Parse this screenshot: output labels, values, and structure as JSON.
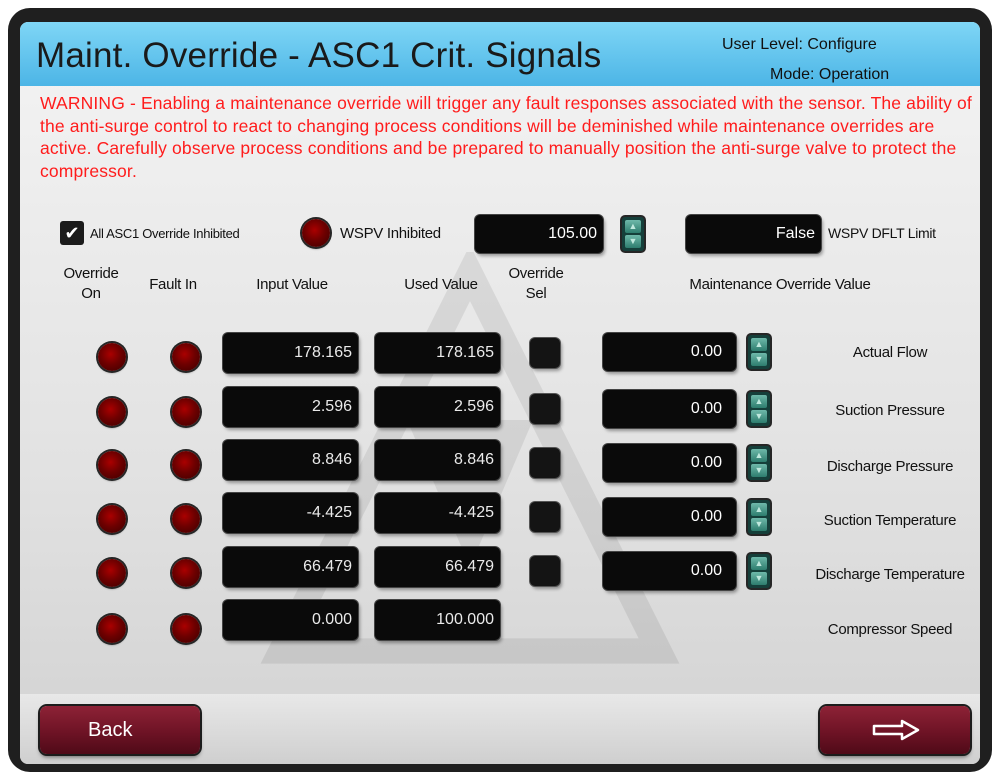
{
  "header": {
    "title": "Maint. Override - ASC1 Crit. Signals",
    "user_level": "User Level: Configure",
    "mode": "Mode: Operation"
  },
  "warning": "WARNING - Enabling a maintenance override will trigger any fault responses associated with the sensor. The ability of the anti-surge control to react to changing process conditions will be deminished while maintenance overrides are active. Carefully observe process conditions and be prepared to manually position the anti-surge valve to protect the compressor.",
  "options": {
    "all_inhibited_label": "All ASC1 Override Inhibited",
    "all_inhibited_checked": true,
    "wspv_inhibited_label": "WSPV Inhibited",
    "wspv_value": "105.00",
    "wspv_dflt_value": "False",
    "wspv_dflt_label": "WSPV DFLT Limit"
  },
  "columns": {
    "override_on": "Override\nOn",
    "fault_in": "Fault In",
    "input_value": "Input Value",
    "used_value": "Used Value",
    "override_sel": "Override\nSel",
    "maint_value": "Maintenance Override Value"
  },
  "rows": [
    {
      "input": "178.165",
      "used": "178.165",
      "override": "0.00",
      "label": "Actual Flow"
    },
    {
      "input": "2.596",
      "used": "2.596",
      "override": "0.00",
      "label": "Suction Pressure"
    },
    {
      "input": "8.846",
      "used": "8.846",
      "override": "0.00",
      "label": "Discharge Pressure"
    },
    {
      "input": "-4.425",
      "used": "-4.425",
      "override": "0.00",
      "label": "Suction Temperature"
    },
    {
      "input": "66.479",
      "used": "66.479",
      "override": "0.00",
      "label": "Discharge Temperature"
    },
    {
      "input": "0.000",
      "used": "100.000",
      "label": "Compressor Speed"
    }
  ],
  "footer": {
    "back_label": "Back",
    "next_icon": "right-arrow-icon"
  },
  "colors": {
    "title_bar": "#4cb5e6",
    "warning_text": "#ff1c1c",
    "button": "#6e1325",
    "led": "#7a0000"
  }
}
